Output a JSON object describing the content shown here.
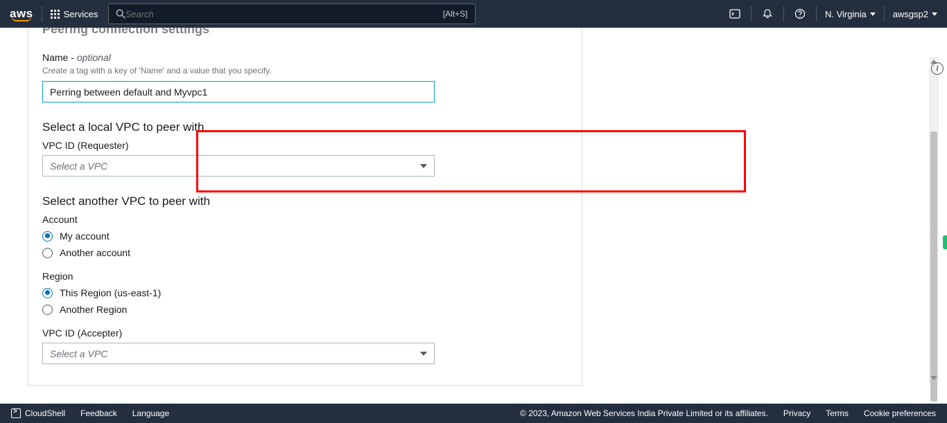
{
  "nav": {
    "logo": "aws",
    "services": "Services",
    "search_placeholder": "Search",
    "search_shortcut": "[Alt+S]",
    "region": "N. Virginia",
    "user": "awsgsp2"
  },
  "panel": {
    "title": "Peering connection settings",
    "name_field": {
      "label": "Name",
      "dash": " - ",
      "optional": "optional",
      "hint": "Create a tag with a key of 'Name' and a value that you specify.",
      "value": "Perring between default and Myvpc1"
    },
    "local_vpc": {
      "heading": "Select a local VPC to peer with",
      "label": "VPC ID (Requester)",
      "placeholder": "Select a VPC"
    },
    "another_vpc": {
      "heading": "Select another VPC to peer with",
      "account_label": "Account",
      "account_options": [
        "My account",
        "Another account"
      ],
      "account_selected": 0,
      "region_label": "Region",
      "region_options": [
        "This Region (us-east-1)",
        "Another Region"
      ],
      "region_selected": 0,
      "accepter_label": "VPC ID (Accepter)",
      "accepter_placeholder": "Select a VPC"
    }
  },
  "footer": {
    "cloudshell": "CloudShell",
    "feedback": "Feedback",
    "language": "Language",
    "copyright": "© 2023, Amazon Web Services India Private Limited or its affiliates.",
    "privacy": "Privacy",
    "terms": "Terms",
    "cookies": "Cookie preferences"
  }
}
